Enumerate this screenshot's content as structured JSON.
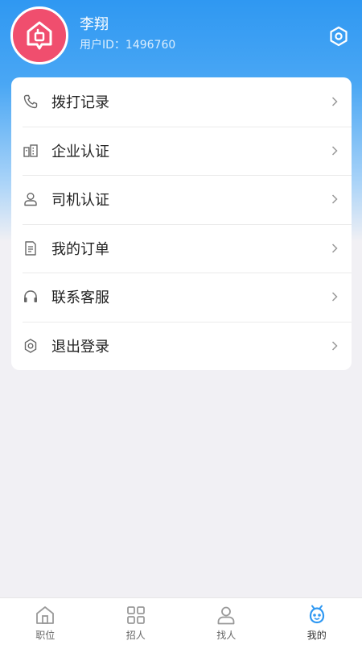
{
  "profile": {
    "name": "李翔",
    "id_label": "用户ID：",
    "id_value": "1496760"
  },
  "menu": {
    "items": [
      {
        "label": "拨打记录",
        "icon": "phone-icon"
      },
      {
        "label": "企业认证",
        "icon": "building-icon"
      },
      {
        "label": "司机认证",
        "icon": "person-icon"
      },
      {
        "label": "我的订单",
        "icon": "document-icon"
      },
      {
        "label": "联系客服",
        "icon": "headset-icon"
      },
      {
        "label": "退出登录",
        "icon": "gear-icon"
      }
    ]
  },
  "tabbar": {
    "tabs": [
      {
        "label": "职位",
        "icon": "home-icon",
        "active": false
      },
      {
        "label": "招人",
        "icon": "grid-icon",
        "active": false
      },
      {
        "label": "找人",
        "icon": "person-icon",
        "active": false
      },
      {
        "label": "我的",
        "icon": "robot-face-icon",
        "active": true
      }
    ]
  },
  "colors": {
    "accent": "#2f98f2",
    "avatar_bg": "#f04e6e",
    "active_tab": "#2f98f2"
  }
}
